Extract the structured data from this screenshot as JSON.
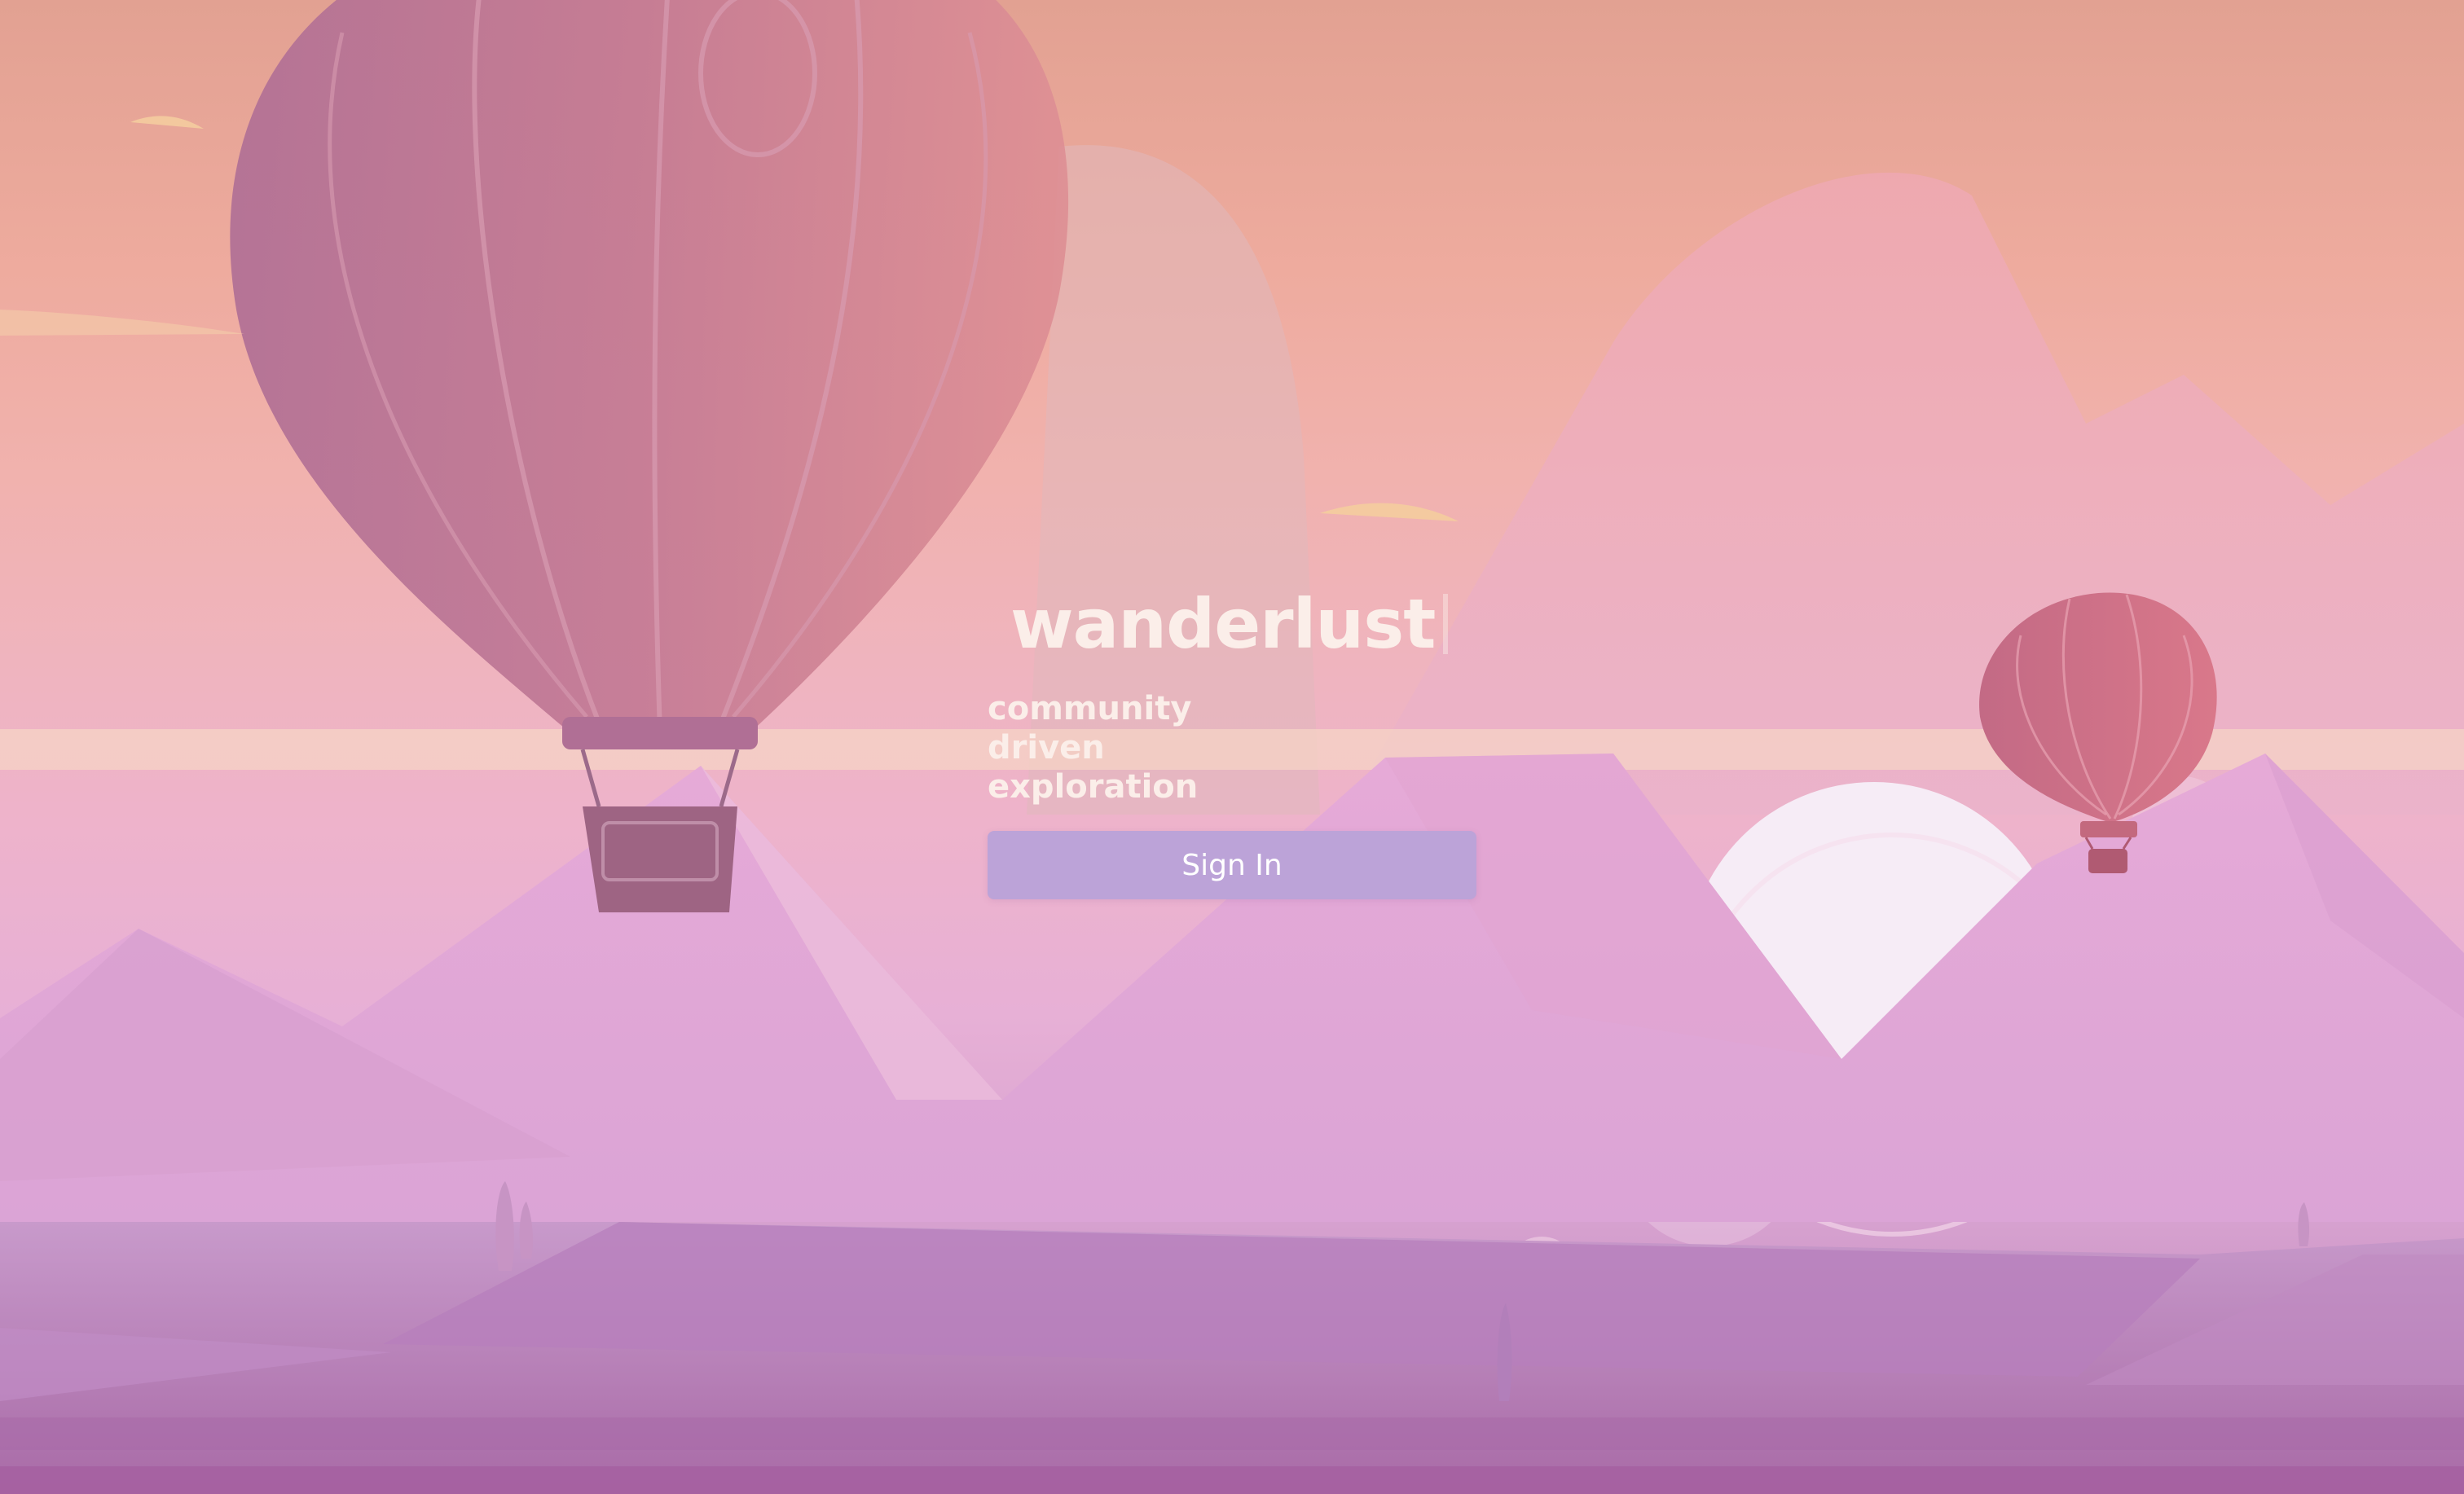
{
  "app": {
    "title": "wanderlust",
    "tagline": "community driven exploration"
  },
  "actions": {
    "sign_in_label": "Sign In"
  },
  "colors": {
    "sky_top": "#e2a192",
    "sky_mid": "#efb4bf",
    "ground": "#b478b0",
    "text": "#fbeee9",
    "button": "#bca3d8",
    "balloon": "#b8718f"
  },
  "background": {
    "icons": [
      "large-hot-air-balloon-icon",
      "small-hot-air-balloon-icon",
      "setting-sun-icon",
      "mountain-range-icon",
      "fields-icon"
    ]
  }
}
